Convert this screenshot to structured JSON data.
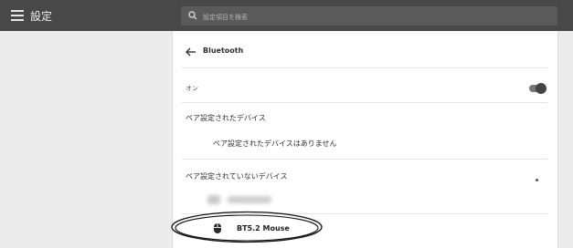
{
  "header": {
    "title": "設定",
    "menu_icon": "hamburger-icon",
    "search": {
      "icon": "search-icon",
      "placeholder": "設定項目を検索"
    }
  },
  "panel": {
    "back_icon": "arrow-left-icon",
    "title": "Bluetooth",
    "toggle": {
      "label": "オン",
      "state": "on"
    },
    "paired": {
      "heading": "ペア設定されたデバイス",
      "empty_text": "ペア設定されたデバイスはありません"
    },
    "unpaired": {
      "heading": "ペア設定されていないデバイス",
      "devices": [
        {
          "name": "BT5.2 Mouse",
          "icon": "mouse-icon",
          "highlighted": true
        }
      ]
    }
  },
  "colors": {
    "topbar": "#484848",
    "background": "#ececec",
    "panel": "#ffffff",
    "toggle_track": "#777777",
    "toggle_knob": "#444444"
  }
}
